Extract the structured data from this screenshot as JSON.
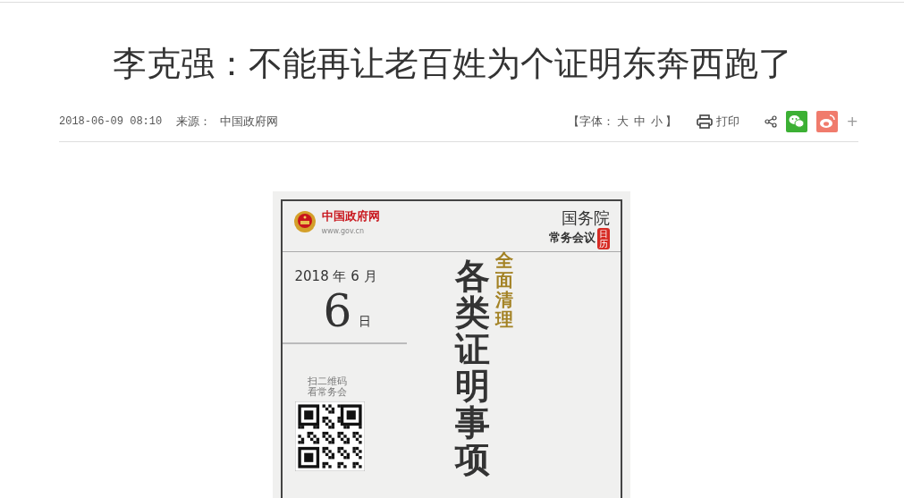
{
  "article": {
    "title": "李克强：不能再让老百姓为个证明东奔西跑了",
    "date": "2018-06-09 08:10",
    "source_label": "来源：",
    "source": "中国政府网",
    "font_size": {
      "open": "【字体：",
      "options": [
        "大",
        "中",
        "小"
      ],
      "close": "】"
    },
    "print": "打印",
    "share_more": "+"
  },
  "poster": {
    "site_name": "中国政府网",
    "site_url": "www.gov.cn",
    "heading": "国务院",
    "subheading": "常务会议",
    "seal": "日历",
    "month": "2018 年 6 月",
    "day": "6",
    "day_unit": "日",
    "qr_caption": [
      "扫二维码",
      "看常务会"
    ],
    "tagline": "全面清理",
    "headline": "各类证明事项"
  }
}
